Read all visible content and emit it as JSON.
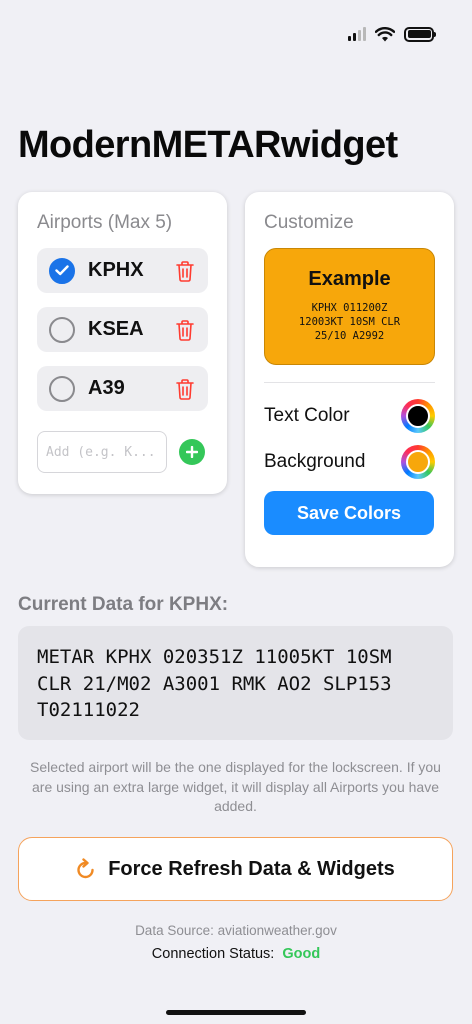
{
  "title": "ModernMETARwidget",
  "airports": {
    "heading": "Airports (Max 5)",
    "items": [
      {
        "code": "KPHX",
        "selected": true
      },
      {
        "code": "KSEA",
        "selected": false
      },
      {
        "code": "A39",
        "selected": false
      }
    ],
    "add_placeholder": "Add (e.g. K..."
  },
  "customize": {
    "heading": "Customize",
    "example_title": "Example",
    "example_lines": [
      "KPHX 011200Z",
      "12003KT 10SM CLR",
      "25/10 A2992"
    ],
    "example_bg": "#f7a70b",
    "text_color_label": "Text Color",
    "text_color": "#000000",
    "background_label": "Background",
    "background_color": "#f7a70b",
    "save_label": "Save Colors"
  },
  "current": {
    "heading": "Current Data for KPHX:",
    "metar_lines": [
      "METAR KPHX 020351Z 11005KT 10SM",
      "CLR 21/M02 A3001 RMK AO2 SLP153",
      "T02111022"
    ]
  },
  "info_text": "Selected airport will be the one displayed for the lockscreen. If you are using an extra large widget, it will display all Airports you have added.",
  "refresh_label": "Force Refresh Data & Widgets",
  "footer": {
    "data_source": "Data Source: aviationweather.gov",
    "connection_label": "Connection Status:",
    "connection_value": "Good"
  },
  "icons": [
    "signal-icon",
    "wifi-icon",
    "battery-icon",
    "checkmark-icon",
    "trash-icon",
    "plus-icon",
    "refresh-icon"
  ],
  "colors": {
    "accent_blue": "#1a8cff",
    "check_blue": "#1a73e8",
    "delete_red": "#ff3b30",
    "add_green": "#34c759",
    "refresh_orange": "#f5a35c"
  }
}
